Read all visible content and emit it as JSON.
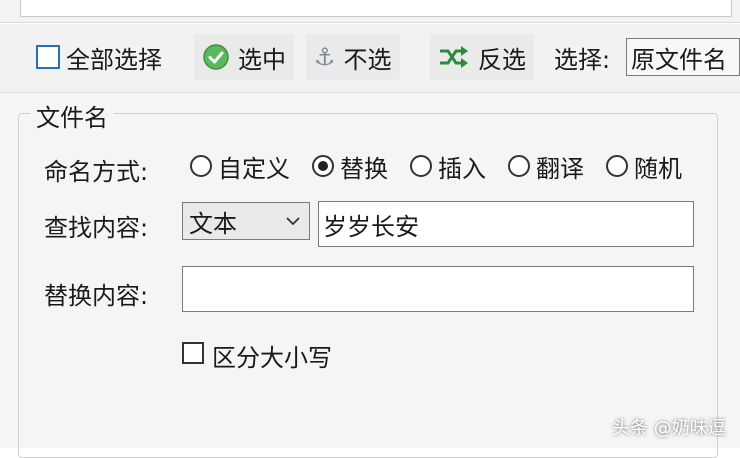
{
  "toolbar": {
    "select_all_label": "全部选择",
    "select_label": "选中",
    "deselect_label": "不选",
    "invert_label": "反选",
    "choose_label": "选择:",
    "choose_value": "原文件名"
  },
  "filename_group": {
    "title": "文件名",
    "naming_label": "命名方式:",
    "naming_options": [
      "自定义",
      "替换",
      "插入",
      "翻译",
      "随机"
    ],
    "naming_selected": "替换",
    "find_label": "查找内容:",
    "find_type": "文本",
    "find_value": "岁岁长安",
    "replace_label": "替换内容:",
    "replace_value": "",
    "case_label": "区分大小写"
  },
  "watermark": "头条 @奶味逗",
  "colors": {
    "accent": "#2b6fb3",
    "ok_green": "#4caf50",
    "shuffle_green": "#2e8b3a"
  },
  "icons": [
    "checkbox-icon",
    "ok-icon",
    "anchor-icon",
    "shuffle-icon",
    "chevron-down-icon"
  ]
}
